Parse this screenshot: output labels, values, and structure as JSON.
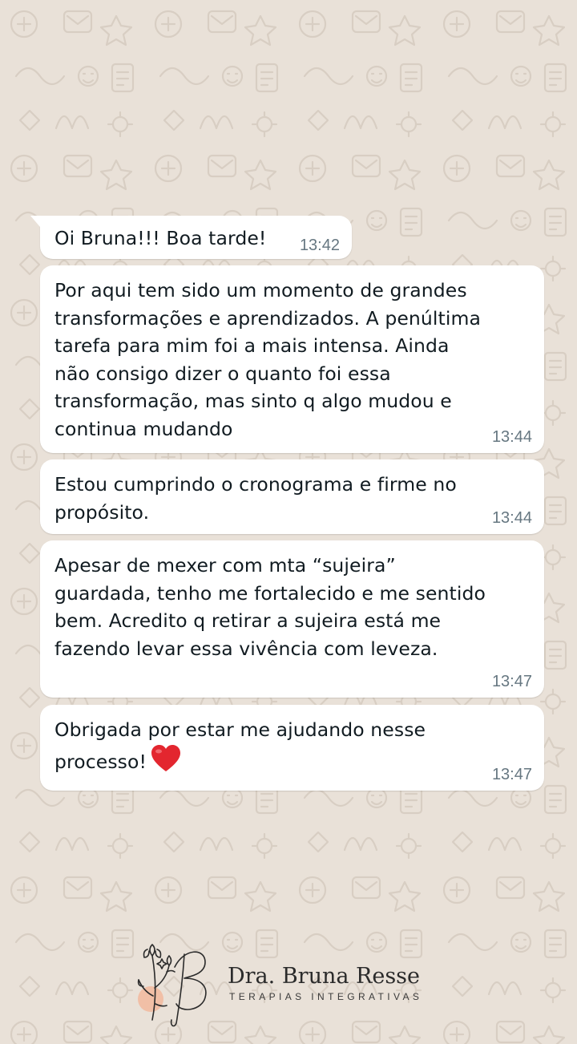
{
  "conversation": {
    "messages": [
      {
        "text": "Oi Bruna!!! Boa tarde!",
        "time": "13:42"
      },
      {
        "text": "Por aqui tem sido um momento de grandes\ntransformações e aprendizados. A penúltima\ntarefa para mim foi a mais intensa. Ainda\nnão consigo dizer o quanto foi essa\ntransformação, mas sinto q algo mudou e\ncontinua mudando",
        "time": "13:44"
      },
      {
        "text": "Estou cumprindo o cronograma e firme no\npropósito.",
        "time": "13:44"
      },
      {
        "text": "Apesar de mexer com mta “sujeira”\nguardada, tenho me fortalecido e me sentido\nbem. Acredito q retirar a sujeira está me\nfazendo levar essa vivência com leveza.",
        "time": "13:47"
      },
      {
        "text": "Obrigada por estar me ajudando nesse\nprocesso!",
        "emoji": "red-heart-icon",
        "time": "13:47"
      }
    ]
  },
  "branding": {
    "name": "Dra. Bruna Resse",
    "tagline": "TERAPIAS INTEGRATIVAS",
    "accent_color": "#f2b89e"
  },
  "colors": {
    "wallpaper": "#e9e1d8",
    "bubble": "#ffffff",
    "text": "#111b21",
    "time": "#667781",
    "heart": "#e3262f"
  }
}
